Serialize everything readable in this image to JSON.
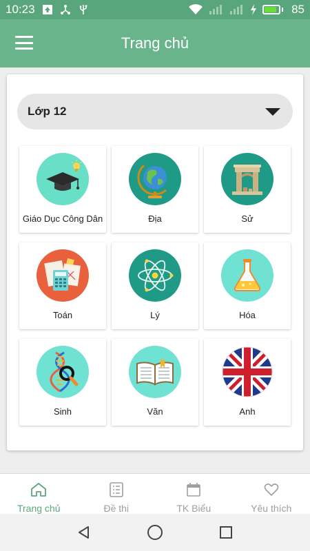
{
  "status_bar": {
    "time": "10:23",
    "battery_percent": "85",
    "battery_level": 0.85,
    "icons": [
      "upload-icon",
      "usb-share-icon",
      "usb-icon",
      "wifi-icon",
      "signal-icon",
      "signal-icon",
      "charging-icon",
      "battery-icon"
    ]
  },
  "app_bar": {
    "title": "Trang chủ",
    "menu_icon": "hamburger-menu-icon"
  },
  "grade_selector": {
    "selected": "Lớp 12"
  },
  "subjects": [
    {
      "label": "Giáo Dục Công Dân",
      "icon": "graduation-cap-icon",
      "bg": "#69dfc7"
    },
    {
      "label": "Địa",
      "icon": "globe-icon",
      "bg": "#1e9a87"
    },
    {
      "label": "Sử",
      "icon": "ruins-icon",
      "bg": "#1e9a87"
    },
    {
      "label": "Toán",
      "icon": "calculator-icon",
      "bg": "#e8613c"
    },
    {
      "label": "Lý",
      "icon": "atom-icon",
      "bg": "#1e9a87"
    },
    {
      "label": "Hóa",
      "icon": "flask-icon",
      "bg": "#6fe2d4"
    },
    {
      "label": "Sinh",
      "icon": "dna-icon",
      "bg": "#6fe2d4"
    },
    {
      "label": "Văn",
      "icon": "book-icon",
      "bg": "#6fe2d4"
    },
    {
      "label": "Anh",
      "icon": "uk-flag-icon",
      "bg": "#ffffff"
    }
  ],
  "bottom_nav": [
    {
      "label": "Trang chủ",
      "icon": "home-icon",
      "active": true
    },
    {
      "label": "Đề thi",
      "icon": "list-icon",
      "active": false
    },
    {
      "label": "TK Biểu",
      "icon": "calendar-icon",
      "active": false
    },
    {
      "label": "Yêu thích",
      "icon": "heart-icon",
      "active": false
    }
  ],
  "colors": {
    "primary": "#6ab48c",
    "status_bar": "#5aa67c",
    "active_tab": "#5aa67c",
    "inactive_tab": "#9e9e9e"
  }
}
